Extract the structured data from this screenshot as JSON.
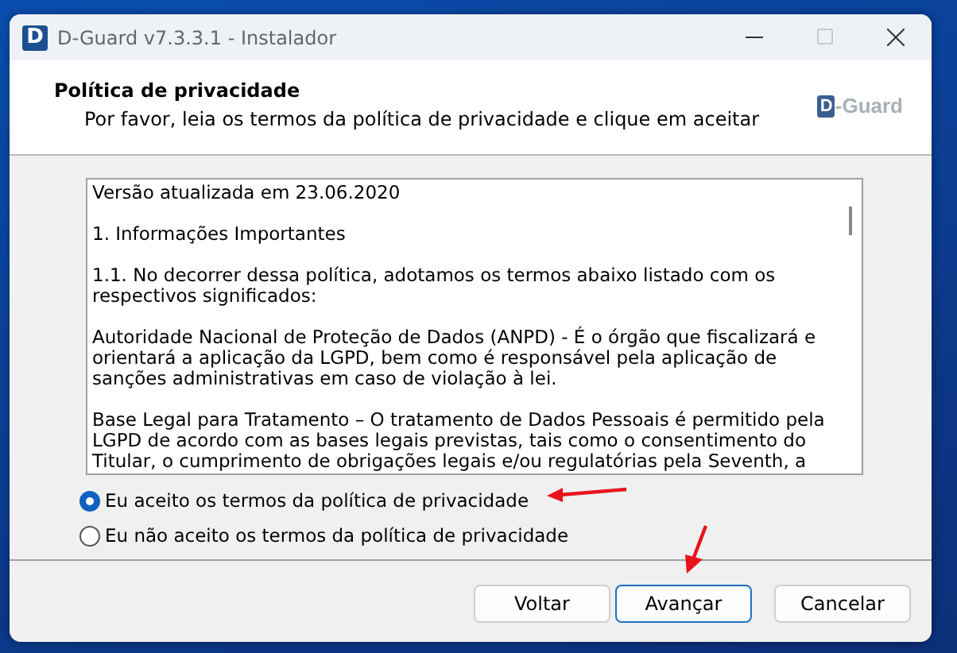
{
  "window": {
    "icon_letter": "D",
    "title": "D-Guard v7.3.3.1 - Instalador"
  },
  "header": {
    "title": "Política de privacidade",
    "subtitle": "Por favor, leia os termos da política de privacidade e clique em aceitar",
    "logo_letter": "D",
    "logo_text": "-Guard"
  },
  "license_text": [
    {
      "lines": [
        "Versão atualizada em 23.06.2020"
      ]
    },
    {
      "lines": [
        "1. Informações Importantes"
      ]
    },
    {
      "lines": [
        "1.1. No decorrer dessa política, adotamos os termos abaixo listado com os",
        "respectivos significados:"
      ]
    },
    {
      "lines": [
        "Autoridade Nacional de Proteção de Dados (ANPD) - É o órgão que fiscalizará e",
        "orientará a aplicação da LGPD, bem como é responsável pela aplicação de",
        "sanções administrativas em caso de violação à lei."
      ]
    },
    {
      "lines": [
        "Base Legal para Tratamento – O tratamento de Dados Pessoais é permitido pela",
        "LGPD de acordo com as bases legais previstas, tais como o consentimento do",
        "Titular, o cumprimento de obrigações legais e/ou regulatórias pela Seventh, a"
      ]
    }
  ],
  "options": [
    {
      "label": "Eu aceito os termos da política de privacidade",
      "selected": true
    },
    {
      "label": "Eu não aceito os termos da política de privacidade",
      "selected": false
    }
  ],
  "buttons": [
    {
      "label": "Voltar",
      "default": false
    },
    {
      "label": "Avançar",
      "default": true
    },
    {
      "label": "Cancelar",
      "default": false
    }
  ]
}
